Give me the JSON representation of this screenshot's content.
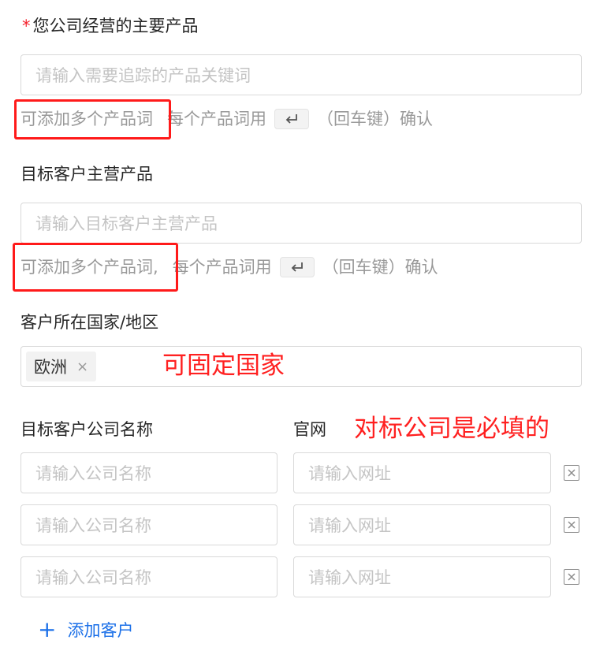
{
  "fields": {
    "main_products": {
      "required_mark": "*",
      "label": "您公司经营的主要产品",
      "placeholder": "请输入需要追踪的产品关键词",
      "hint_main": "可添加多个产品词",
      "hint_after": "每个产品词用",
      "hint_end": "（回车键）确认"
    },
    "target_products": {
      "label": "目标客户主营产品",
      "placeholder": "请输入目标客户主营产品",
      "hint_main": "可添加多个产品词",
      "hint_comma": ",",
      "hint_after": "每个产品词用",
      "hint_end": "（回车键）确认"
    },
    "country": {
      "label": "客户所在国家/地区",
      "tags": [
        "欧洲"
      ],
      "tag_remove": "×"
    },
    "companies": {
      "company_label": "目标客户公司名称",
      "website_label": "官网",
      "company_placeholder": "请输入公司名称",
      "website_placeholder": "请输入网址",
      "rows": 3,
      "add_label": "添加客户",
      "add_icon": "+"
    }
  },
  "annotations": {
    "country_note": "可固定国家",
    "companies_note": "对标公司是必填的",
    "color": "#ff1a1a"
  },
  "icons": {
    "enter_key": "enter-key-icon",
    "delete_row": "delete-row-icon"
  },
  "colors": {
    "link": "#1a6fe8",
    "required": "#f5222d",
    "placeholder": "#c4c4c4",
    "hint": "#999999"
  }
}
